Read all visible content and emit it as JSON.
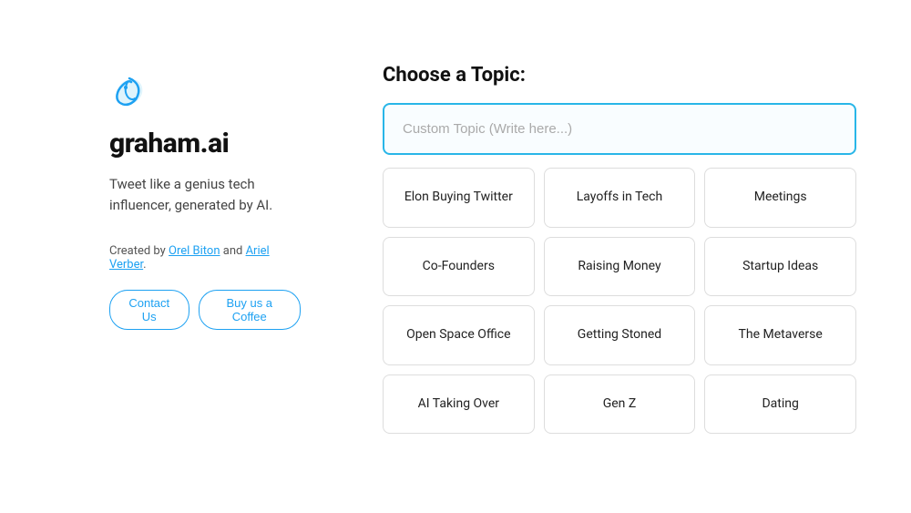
{
  "left": {
    "logo_alt": "graham.ai bird logo",
    "brand_name": "graham.ai",
    "tagline": "Tweet like a genius tech influencer, generated by AI.",
    "credits_prefix": "Created by ",
    "creator1": "Orel Biton",
    "credits_and": " and ",
    "creator2": "Ariel Verber",
    "credits_suffix": ".",
    "contact_label": "Contact Us",
    "coffee_label": "Buy us a Coffee"
  },
  "right": {
    "section_title": "Choose a Topic:",
    "input_placeholder": "Custom Topic (Write here...)",
    "topics": [
      {
        "label": "Elon Buying Twitter"
      },
      {
        "label": "Layoffs in Tech"
      },
      {
        "label": "Meetings"
      },
      {
        "label": "Co-Founders"
      },
      {
        "label": "Raising Money"
      },
      {
        "label": "Startup Ideas"
      },
      {
        "label": "Open Space Office"
      },
      {
        "label": "Getting Stoned"
      },
      {
        "label": "The Metaverse"
      },
      {
        "label": "AI Taking Over"
      },
      {
        "label": "Gen Z"
      },
      {
        "label": "Dating"
      }
    ]
  },
  "colors": {
    "brand_blue": "#1da1f2",
    "border_input": "#29b6e8"
  }
}
